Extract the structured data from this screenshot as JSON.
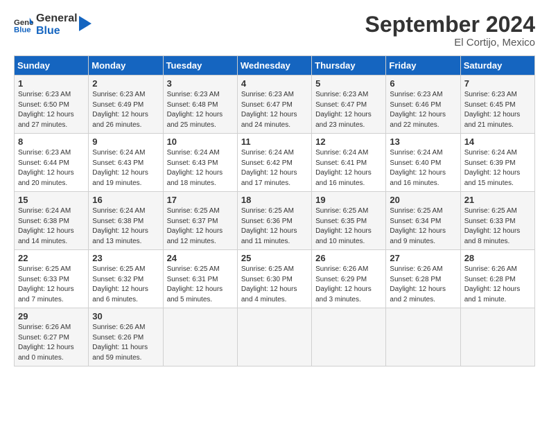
{
  "header": {
    "logo_general": "General",
    "logo_blue": "Blue",
    "month": "September 2024",
    "location": "El Cortijo, Mexico"
  },
  "weekdays": [
    "Sunday",
    "Monday",
    "Tuesday",
    "Wednesday",
    "Thursday",
    "Friday",
    "Saturday"
  ],
  "weeks": [
    [
      {
        "day": "1",
        "sunrise": "6:23 AM",
        "sunset": "6:50 PM",
        "daylight": "12 hours and 27 minutes."
      },
      {
        "day": "2",
        "sunrise": "6:23 AM",
        "sunset": "6:49 PM",
        "daylight": "12 hours and 26 minutes."
      },
      {
        "day": "3",
        "sunrise": "6:23 AM",
        "sunset": "6:48 PM",
        "daylight": "12 hours and 25 minutes."
      },
      {
        "day": "4",
        "sunrise": "6:23 AM",
        "sunset": "6:47 PM",
        "daylight": "12 hours and 24 minutes."
      },
      {
        "day": "5",
        "sunrise": "6:23 AM",
        "sunset": "6:47 PM",
        "daylight": "12 hours and 23 minutes."
      },
      {
        "day": "6",
        "sunrise": "6:23 AM",
        "sunset": "6:46 PM",
        "daylight": "12 hours and 22 minutes."
      },
      {
        "day": "7",
        "sunrise": "6:23 AM",
        "sunset": "6:45 PM",
        "daylight": "12 hours and 21 minutes."
      }
    ],
    [
      {
        "day": "8",
        "sunrise": "6:23 AM",
        "sunset": "6:44 PM",
        "daylight": "12 hours and 20 minutes."
      },
      {
        "day": "9",
        "sunrise": "6:24 AM",
        "sunset": "6:43 PM",
        "daylight": "12 hours and 19 minutes."
      },
      {
        "day": "10",
        "sunrise": "6:24 AM",
        "sunset": "6:43 PM",
        "daylight": "12 hours and 18 minutes."
      },
      {
        "day": "11",
        "sunrise": "6:24 AM",
        "sunset": "6:42 PM",
        "daylight": "12 hours and 17 minutes."
      },
      {
        "day": "12",
        "sunrise": "6:24 AM",
        "sunset": "6:41 PM",
        "daylight": "12 hours and 16 minutes."
      },
      {
        "day": "13",
        "sunrise": "6:24 AM",
        "sunset": "6:40 PM",
        "daylight": "12 hours and 16 minutes."
      },
      {
        "day": "14",
        "sunrise": "6:24 AM",
        "sunset": "6:39 PM",
        "daylight": "12 hours and 15 minutes."
      }
    ],
    [
      {
        "day": "15",
        "sunrise": "6:24 AM",
        "sunset": "6:38 PM",
        "daylight": "12 hours and 14 minutes."
      },
      {
        "day": "16",
        "sunrise": "6:24 AM",
        "sunset": "6:38 PM",
        "daylight": "12 hours and 13 minutes."
      },
      {
        "day": "17",
        "sunrise": "6:25 AM",
        "sunset": "6:37 PM",
        "daylight": "12 hours and 12 minutes."
      },
      {
        "day": "18",
        "sunrise": "6:25 AM",
        "sunset": "6:36 PM",
        "daylight": "12 hours and 11 minutes."
      },
      {
        "day": "19",
        "sunrise": "6:25 AM",
        "sunset": "6:35 PM",
        "daylight": "12 hours and 10 minutes."
      },
      {
        "day": "20",
        "sunrise": "6:25 AM",
        "sunset": "6:34 PM",
        "daylight": "12 hours and 9 minutes."
      },
      {
        "day": "21",
        "sunrise": "6:25 AM",
        "sunset": "6:33 PM",
        "daylight": "12 hours and 8 minutes."
      }
    ],
    [
      {
        "day": "22",
        "sunrise": "6:25 AM",
        "sunset": "6:33 PM",
        "daylight": "12 hours and 7 minutes."
      },
      {
        "day": "23",
        "sunrise": "6:25 AM",
        "sunset": "6:32 PM",
        "daylight": "12 hours and 6 minutes."
      },
      {
        "day": "24",
        "sunrise": "6:25 AM",
        "sunset": "6:31 PM",
        "daylight": "12 hours and 5 minutes."
      },
      {
        "day": "25",
        "sunrise": "6:25 AM",
        "sunset": "6:30 PM",
        "daylight": "12 hours and 4 minutes."
      },
      {
        "day": "26",
        "sunrise": "6:26 AM",
        "sunset": "6:29 PM",
        "daylight": "12 hours and 3 minutes."
      },
      {
        "day": "27",
        "sunrise": "6:26 AM",
        "sunset": "6:28 PM",
        "daylight": "12 hours and 2 minutes."
      },
      {
        "day": "28",
        "sunrise": "6:26 AM",
        "sunset": "6:28 PM",
        "daylight": "12 hours and 1 minute."
      }
    ],
    [
      {
        "day": "29",
        "sunrise": "6:26 AM",
        "sunset": "6:27 PM",
        "daylight": "12 hours and 0 minutes."
      },
      {
        "day": "30",
        "sunrise": "6:26 AM",
        "sunset": "6:26 PM",
        "daylight": "11 hours and 59 minutes."
      },
      null,
      null,
      null,
      null,
      null
    ]
  ]
}
